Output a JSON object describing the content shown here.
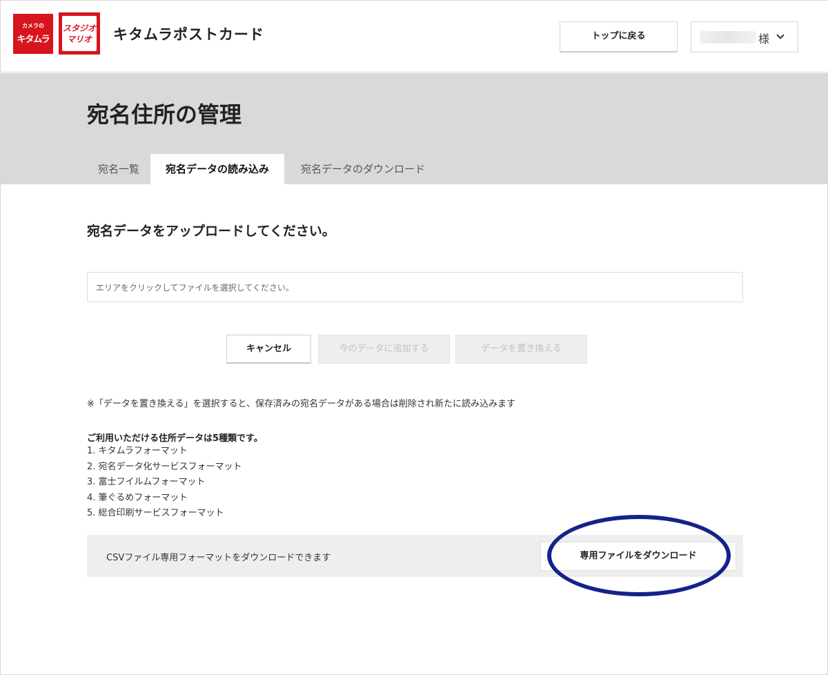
{
  "header": {
    "logo_kitamura_line1": "カメラの",
    "logo_kitamura_line2": "キタムラ",
    "logo_studio_line1": "スタジオ",
    "logo_studio_line2": "マリオ",
    "site_title": "キタムラポストカード",
    "back_to_top_label": "トップに戻る",
    "user_suffix": "様"
  },
  "page": {
    "title": "宛名住所の管理",
    "tabs": [
      {
        "label": "宛名一覧",
        "active": false
      },
      {
        "label": "宛名データの読み込み",
        "active": true
      },
      {
        "label": "宛名データのダウンロード",
        "active": false
      }
    ]
  },
  "upload": {
    "heading": "宛名データをアップロードしてください。",
    "file_area_placeholder": "エリアをクリックしてファイルを選択してください。",
    "cancel_label": "キャンセル",
    "add_label": "今のデータに追加する",
    "replace_label": "データを置き換える",
    "note": "※「データを置き換える」を選択すると、保存済みの宛名データがある場合は削除され新たに読み込みます"
  },
  "formats": {
    "title": "ご利用いただける住所データは5種類です。",
    "items": [
      "1. キタムラフォーマット",
      "2. 宛名データ化サービスフォーマット",
      "3. 富士フイルムフォーマット",
      "4. 筆ぐるめフォーマット",
      "5. 総合印刷サービスフォーマット"
    ]
  },
  "download": {
    "text": "CSVファイル専用フォーマットをダウンロードできます",
    "button_label": "専用ファイルをダウンロード"
  },
  "colors": {
    "brand_red": "#d8141e",
    "title_band": "#d9d9d9",
    "highlight_ring": "#15228a"
  }
}
